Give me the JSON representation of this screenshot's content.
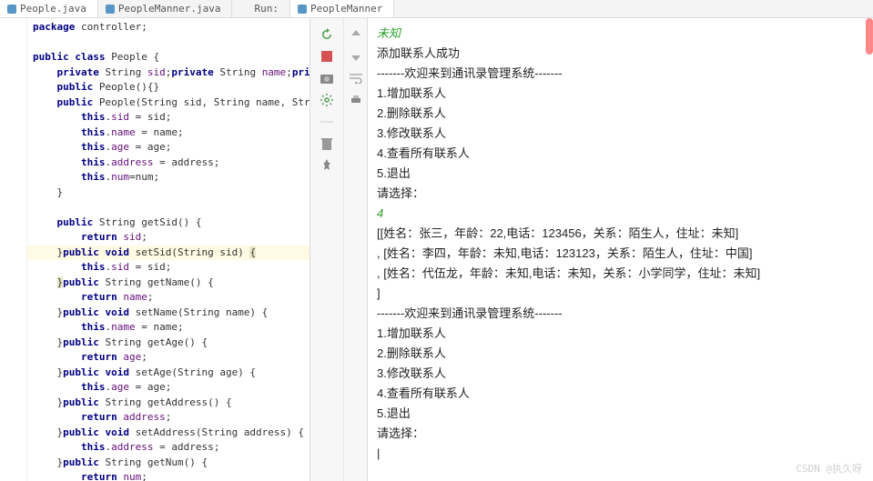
{
  "tabs": {
    "left1": "People.java",
    "left2": "PeopleManner.java",
    "runLabel": "Run:",
    "rightTab": "PeopleManner"
  },
  "code": {
    "l1": "package controller;",
    "l2": "",
    "l3": "public class People {",
    "l4": "    private String sid;private String name;private",
    "l5": "    public People(){}",
    "l6": "    public People(String sid, String name, String ",
    "l7": "        this.sid = sid;",
    "l8": "        this.name = name;",
    "l9": "        this.age = age;",
    "l10": "        this.address = address;",
    "l11": "        this.num=num;",
    "l12": "    }",
    "l13": "",
    "l14": "    public String getSid() {",
    "l15": "        return sid;",
    "l16": "    }public void setSid(String sid) {",
    "l17": "        this.sid = sid;",
    "l18": "    }public String getName() {",
    "l19": "        return name;",
    "l20": "    }public void setName(String name) {",
    "l21": "        this.name = name;",
    "l22": "    }public String getAge() {",
    "l23": "        return age;",
    "l24": "    }public void setAge(String age) {",
    "l25": "        this.age = age;",
    "l26": "    }public String getAddress() {",
    "l27": "        return address;",
    "l28": "    }public void setAddress(String address) {",
    "l29": "        this.address = address;",
    "l30": "    }public String getNum() {",
    "l31": "        return num;"
  },
  "console": {
    "topGreen": "未知",
    "line1": "添加联系人成功",
    "line2": "-------欢迎来到通讯录管理系统-------",
    "m1": "1.增加联系人",
    "m2": "2.删除联系人",
    "m3": "3.修改联系人",
    "m4": "4.查看所有联系人",
    "m5": "5.退出",
    "prompt": "请选择：",
    "input": "4",
    "d1": "[[姓名：张三，年龄：22,电话：123456，关系：陌生人，住址：未知]",
    "d2": ", [姓名：李四，年龄：未知,电话：123123，关系：陌生人，住址：中国]",
    "d3": ", [姓名：代伍龙，年龄：未知,电话：未知，关系：小学同学，住址：未知]",
    "d4": "]",
    "line3": "-------欢迎来到通讯录管理系统-------",
    "cursor": "|"
  },
  "watermark": "CSDN @执久呀"
}
